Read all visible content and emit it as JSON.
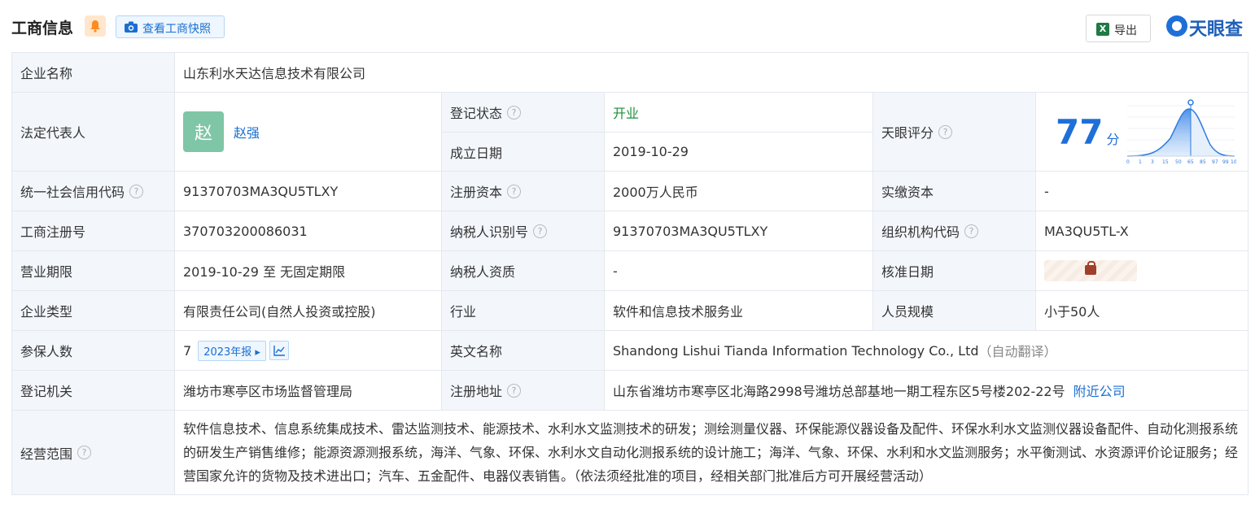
{
  "header": {
    "title": "工商信息",
    "snapshot_label": "查看工商快照",
    "export_label": "导出",
    "logo_text": "天眼查"
  },
  "rows": {
    "company_name": {
      "label": "企业名称",
      "value": "山东利水天达信息技术有限公司"
    },
    "legal_rep": {
      "label": "法定代表人",
      "avatar": "赵",
      "name": "赵强"
    },
    "reg_status": {
      "label": "登记状态",
      "value": "开业"
    },
    "found_date": {
      "label": "成立日期",
      "value": "2019-10-29"
    },
    "score": {
      "label": "天眼评分",
      "value": "77",
      "unit": "分",
      "axis_ticks": [
        "0",
        "1",
        "3",
        "15",
        "50",
        "65",
        "85",
        "97",
        "99",
        "100"
      ]
    },
    "credit_code": {
      "label": "统一社会信用代码",
      "value": "91370703MA3QU5TLXY"
    },
    "reg_capital": {
      "label": "注册资本",
      "value": "2000万人民币"
    },
    "paid_capital": {
      "label": "实缴资本",
      "value": "-"
    },
    "reg_number": {
      "label": "工商注册号",
      "value": "370703200086031"
    },
    "taxpayer_id": {
      "label": "纳税人识别号",
      "value": "91370703MA3QU5TLXY"
    },
    "org_code": {
      "label": "组织机构代码",
      "value": "MA3QU5TL-X"
    },
    "business_term": {
      "label": "营业期限",
      "value": "2019-10-29 至 无固定期限"
    },
    "taxpayer_qual": {
      "label": "纳税人资质",
      "value": "-"
    },
    "approval_date": {
      "label": "核准日期"
    },
    "company_type": {
      "label": "企业类型",
      "value": "有限责任公司(自然人投资或控股)"
    },
    "industry": {
      "label": "行业",
      "value": "软件和信息技术服务业"
    },
    "staff_size": {
      "label": "人员规模",
      "value": "小于50人"
    },
    "insured": {
      "label": "参保人数",
      "value": "7",
      "report": "2023年报"
    },
    "english_name": {
      "label": "英文名称",
      "value": "Shandong Lishui Tianda Information Technology Co., Ltd",
      "note": "（自动翻译）"
    },
    "authority": {
      "label": "登记机关",
      "value": "潍坊市寒亭区市场监督管理局"
    },
    "address": {
      "label": "注册地址",
      "value": "山东省潍坊市寒亭区北海路2998号潍坊总部基地一期工程东区5号楼202-22号",
      "link": "附近公司"
    },
    "scope": {
      "label": "经营范围",
      "value": "软件信息技术、信息系统集成技术、雷达监测技术、能源技术、水利水文监测技术的研发；测绘测量仪器、环保能源仪器设备及配件、环保水利水文监测仪器设备配件、自动化测报系统的研发生产销售维修；能源资源测报系统，海洋、气象、环保、水利水文自动化测报系统的设计施工；海洋、气象、环保、水利和水文监测服务；水平衡测试、水资源评价论证服务；经营国家允许的货物及技术进出口；汽车、五金配件、电器仪表销售。（依法须经批准的项目，经相关部门批准后方可开展经营活动）"
    }
  },
  "colors": {
    "label_bg": "#f3f6fb",
    "accent": "#1e6fd8",
    "status_green": "#1f8f3a"
  }
}
